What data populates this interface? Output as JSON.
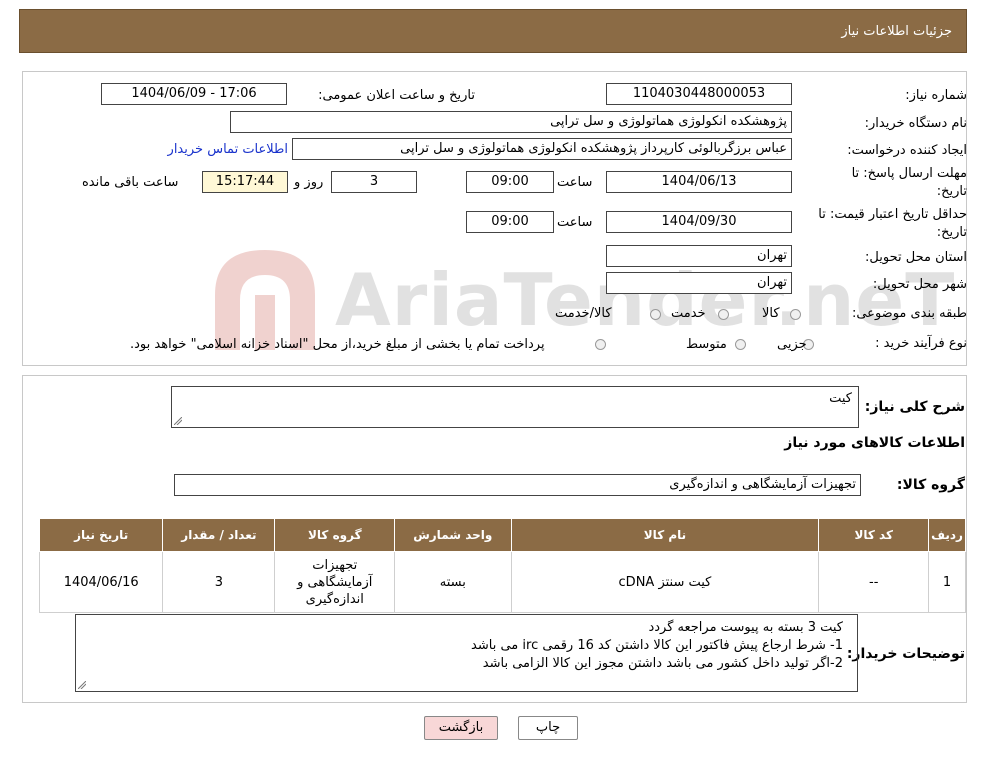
{
  "header": {
    "title": "جزئيات اطلاعات نياز"
  },
  "fields": {
    "need_number_label": "شماره نیاز:",
    "need_number": "1104030448000053",
    "announce_label": "تاریخ و ساعت اعلان عمومی:",
    "announce_value": "1404/06/09 - 17:06",
    "buyer_org_label": "نام دستگاه خریدار:",
    "buyer_org": "پژوهشکده انکولوژی هماتولوژی و سل تراپی",
    "creator_label": "ایجاد کننده درخواست:",
    "creator": "عباس برزگربالوئی کارپرداز پژوهشکده انکولوژی هماتولوژی و سل تراپی",
    "contact_link": "اطلاعات تماس خریدار",
    "deadline_label_1": "مهلت ارسال پاسخ: تا",
    "deadline_label_2": "تاریخ:",
    "deadline_date": "1404/06/13",
    "time_label": "ساعت",
    "deadline_time": "09:00",
    "days_value": "3",
    "days_label": "روز و",
    "remaining_time": "15:17:44",
    "remaining_label": "ساعت باقی مانده",
    "validity_label_1": "حداقل تاریخ اعتبار قیمت: تا",
    "validity_label_2": "تاریخ:",
    "validity_date": "1404/09/30",
    "validity_time": "09:00",
    "province_label": "استان محل تحویل:",
    "province": "تهران",
    "city_label": "شهر محل تحویل:",
    "city": "تهران",
    "category_label": "طبقه بندی موضوعی:",
    "category_options": [
      "کالا",
      "خدمت",
      "کالا/خدمت"
    ],
    "process_label": "نوع فرآیند خرید :",
    "process_options": [
      "جزیی",
      "متوسط"
    ],
    "process_note": "پرداخت تمام یا بخشی از مبلغ خرید،از محل \"اسناد خزانه اسلامی\" خواهد بود."
  },
  "summary": {
    "label": "شرح کلی نیاز:",
    "value": "کیت",
    "goods_info_title": "اطلاعات کالاهای مورد نیاز",
    "group_label": "گروه کالا:",
    "group_value": "تجهیزات آزمایشگاهی و اندازه‌گیری"
  },
  "table": {
    "headers": [
      "ردیف",
      "کد کالا",
      "نام کالا",
      "واحد شمارش",
      "گروه کالا",
      "تعداد / مقدار",
      "تاریخ نیاز"
    ],
    "rows": [
      [
        "1",
        "--",
        "کیت سنتز cDNA",
        "بسته",
        "تجهیزات آزمایشگاهی و اندازه‌گیری",
        "3",
        "1404/06/16"
      ]
    ]
  },
  "notes": {
    "label": "توضیحات خریدار:",
    "line1": "کیت   3 بسته    به پیوست مراجعه گردد",
    "line2": "1- شرط ارجاع پیش فاکتور این کالا داشتن کد 16 رقمی  irc می باشد",
    "line3": "2-اگر تولید داخل  کشور می باشد داشتن مجوز این کالا الزامی باشد"
  },
  "buttons": {
    "print": "چاپ",
    "back": "بازگشت"
  },
  "watermark": {
    "text": "AriaTender.neT"
  },
  "colors": {
    "header_bg": "#8b6b45",
    "link": "#1a33cc",
    "timer_bg": "#fff8d6",
    "back_btn": "#f8d7d7"
  }
}
